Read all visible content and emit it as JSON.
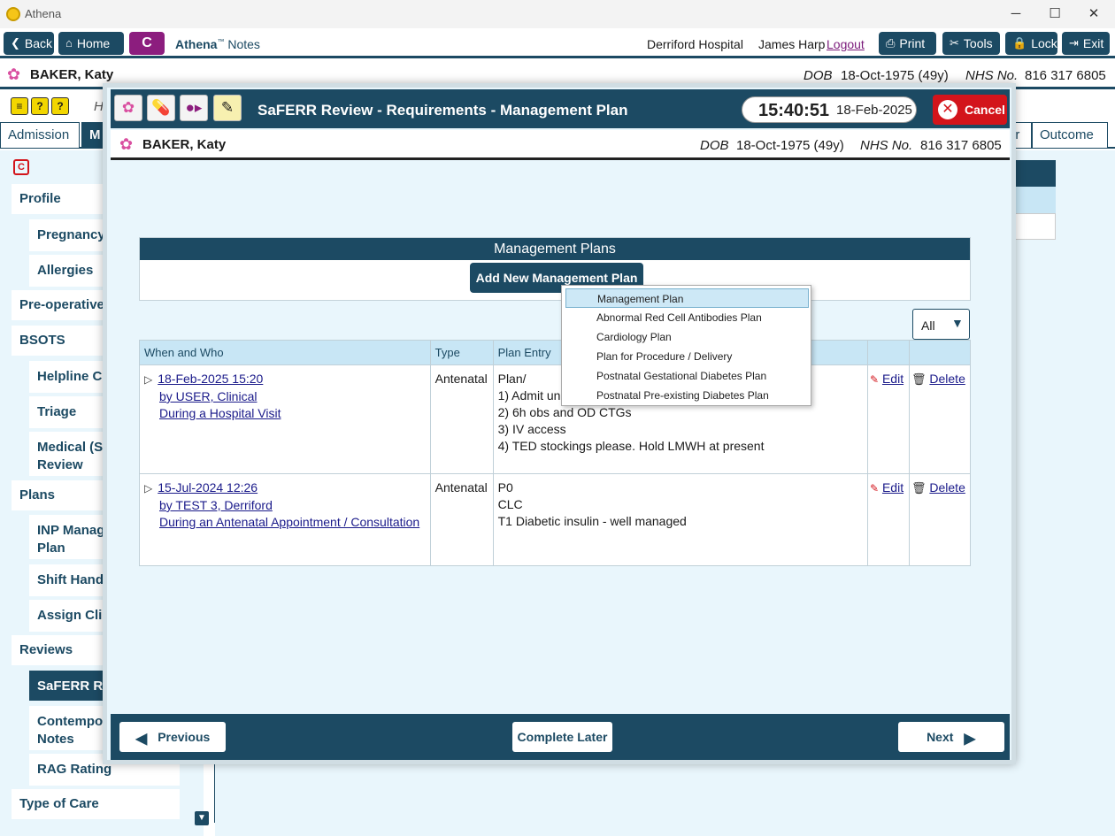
{
  "window": {
    "title": "Athena",
    "minimize": "─",
    "maximize": "☐",
    "close": "✕"
  },
  "toolbar": {
    "back": "Back",
    "home": "Home",
    "c": "C",
    "brand_bold": "Athena",
    "brand_tm": "™",
    "brand_rest": " Notes",
    "hospital": "Derriford Hospital",
    "user": "James Harp",
    "logout": "Logout",
    "print": "Print",
    "tools": "Tools",
    "lock": "Lock",
    "exit": "Exit"
  },
  "patient": {
    "name": "BAKER, Katy",
    "dob_label": "DOB",
    "dob": "18-Oct-1975 (49y)",
    "nhs_label": "NHS No.",
    "nhs": "816 317 6805"
  },
  "strip": {
    "h": "H",
    "q1": "?",
    "q2": "?"
  },
  "tabs": {
    "admission": "Admission",
    "m": "M",
    "ur": "ur",
    "outcome": "Outcome"
  },
  "sidebar": {
    "c_icon": "C",
    "profile": "Profile",
    "pregnancy": "Pregnancy",
    "allergies": "Allergies",
    "preop": "Pre-operative",
    "bsots": "BSOTS",
    "helpline": "Helpline Co",
    "triage": "Triage",
    "medical1": "Medical (Sa",
    "medical2": "Review",
    "plans": "Plans",
    "inp1": "INP Manag",
    "inp2": "Plan",
    "shift": "Shift Hando",
    "assign": "Assign Clin",
    "reviews": "Reviews",
    "saferr": "SaFERR Rev",
    "contemp1": "Contempo",
    "contemp2": "Notes",
    "rag": "RAG Rating",
    "typeofcare": "Type of Care"
  },
  "modal": {
    "title": "SaFERR Review - Requirements - Management Plan",
    "time": "15:40:51",
    "date": "18-Feb-2025",
    "cancel": "Cancel",
    "panel_title": "Management Plans",
    "add_plan": "Add New Management Plan",
    "filter": "All",
    "columns": {
      "when": "When and Who",
      "type": "Type",
      "entry": "Plan Entry"
    },
    "rows": [
      {
        "date": "18-Feb-2025 15:20",
        "by": "by USER, Clinical",
        "context": "During a Hospital Visit",
        "type": "Antenatal",
        "entry": [
          "Plan/",
          "1) Admit un",
          "2) 6h obs and OD CTGs",
          "3) IV access",
          "4) TED stockings please. Hold LMWH at present"
        ],
        "edit": "Edit",
        "delete": "Delete"
      },
      {
        "date": "15-Jul-2024 12:26",
        "by": "by TEST 3, Derriford",
        "context": "During an Antenatal Appointment / Consultation",
        "type": "Antenatal",
        "entry": [
          "P0",
          "CLC",
          "T1 Diabetic insulin - well managed"
        ],
        "edit": "Edit",
        "delete": "Delete"
      }
    ],
    "dropdown": [
      "Management Plan",
      "Abnormal Red Cell Antibodies Plan",
      "Cardiology Plan",
      "Plan for Procedure / Delivery",
      "Postnatal Gestational Diabetes Plan",
      "Postnatal Pre-existing Diabetes Plan"
    ],
    "footer": {
      "previous": "Previous",
      "complete_later": "Complete Later",
      "next": "Next"
    }
  },
  "colors": {
    "primary": "#1c4a63",
    "accent": "#8c1d7e",
    "cancel": "#d3141b",
    "light_bg": "#e9f6fc"
  }
}
